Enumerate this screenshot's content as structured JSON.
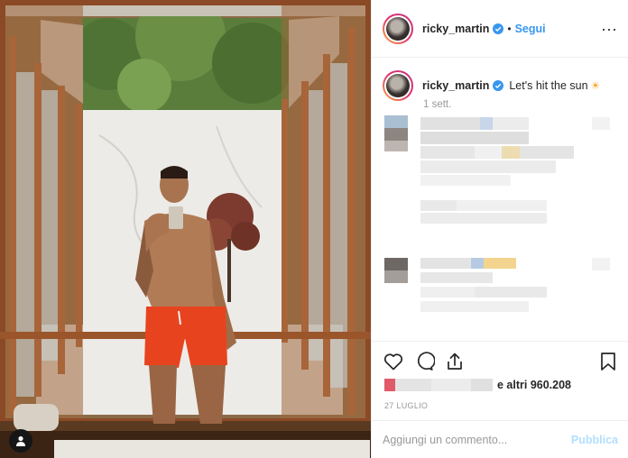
{
  "post": {
    "username": "ricky_martin",
    "follow_label": "Segui",
    "separator": "•",
    "more_label": "···",
    "caption": "Let's hit the sun",
    "caption_emoji": "☀",
    "time_ago": "1 sett.",
    "likes_text": "e altri 960.208",
    "date": "27 LUGLIO"
  },
  "comment_bar": {
    "placeholder": "Aggiungi un commento...",
    "publish_label": "Pubblica"
  },
  "icons": {
    "like": "heart-icon",
    "comment": "speech-bubble-icon",
    "share": "share-icon",
    "save": "bookmark-icon",
    "verified": "verified-badge-icon",
    "user_tag": "user-silhouette-icon"
  },
  "colors": {
    "accent": "#3897f0",
    "publish_disabled": "#b2dffc",
    "muted": "#999999",
    "text": "#262626",
    "swim_shorts": "#e8431f"
  }
}
